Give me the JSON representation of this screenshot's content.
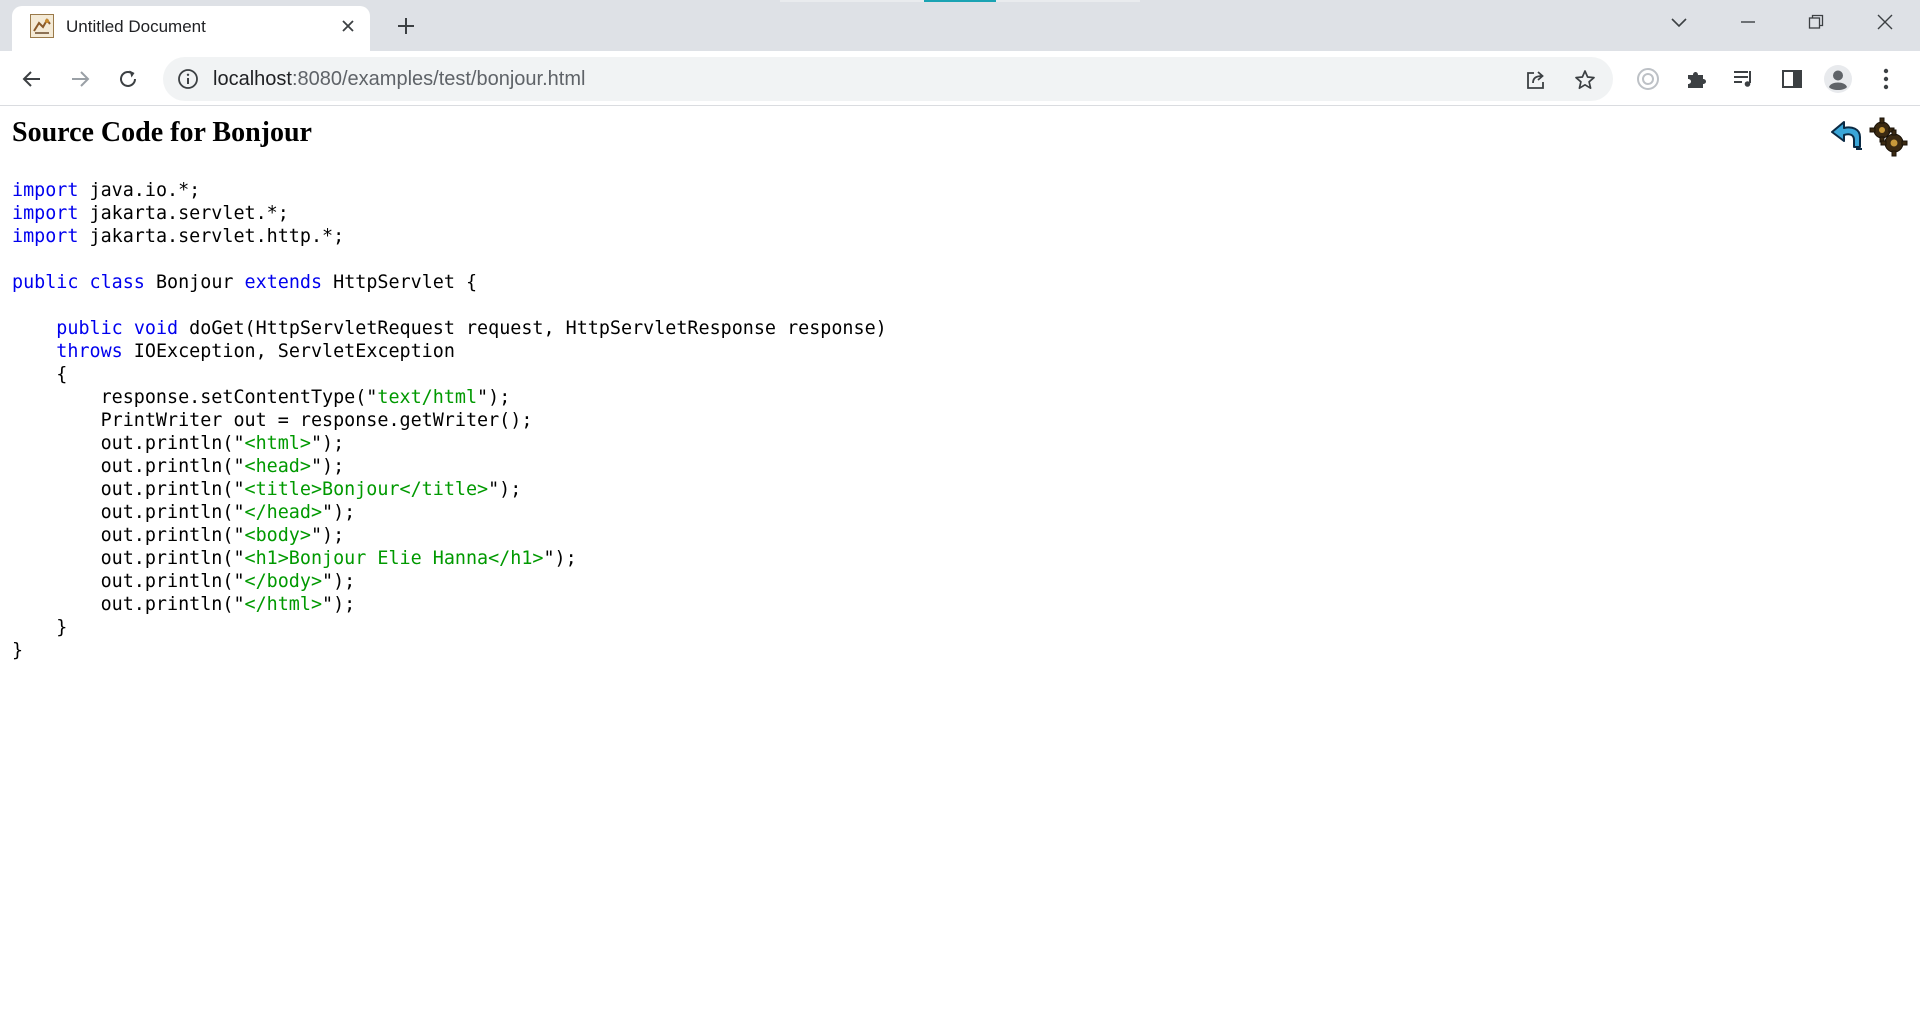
{
  "browser": {
    "tab": {
      "title": "Untitled Document"
    },
    "url": {
      "host": "localhost",
      "path": ":8080/examples/test/bonjour.html"
    }
  },
  "page": {
    "title": "Source Code for Bonjour",
    "code_lines": [
      [
        {
          "t": "import",
          "c": "kw"
        },
        {
          "t": " java.io.*;"
        }
      ],
      [
        {
          "t": "import",
          "c": "kw"
        },
        {
          "t": " jakarta.servlet.*;"
        }
      ],
      [
        {
          "t": "import",
          "c": "kw"
        },
        {
          "t": " jakarta.servlet.http.*;"
        }
      ],
      [],
      [
        {
          "t": "public",
          "c": "kw"
        },
        {
          "t": " "
        },
        {
          "t": "class",
          "c": "kw"
        },
        {
          "t": " Bonjour "
        },
        {
          "t": "extends",
          "c": "kw"
        },
        {
          "t": " HttpServlet {"
        }
      ],
      [],
      [
        {
          "t": "    "
        },
        {
          "t": "public",
          "c": "kw"
        },
        {
          "t": " "
        },
        {
          "t": "void",
          "c": "kw"
        },
        {
          "t": " doGet(HttpServletRequest request, HttpServletResponse response)"
        }
      ],
      [
        {
          "t": "    "
        },
        {
          "t": "throws",
          "c": "kw"
        },
        {
          "t": " IOException, ServletException"
        }
      ],
      [
        {
          "t": "    {"
        }
      ],
      [
        {
          "t": "        response.setContentType(\""
        },
        {
          "t": "text/html",
          "c": "str"
        },
        {
          "t": "\");"
        }
      ],
      [
        {
          "t": "        PrintWriter out = response.getWriter();"
        }
      ],
      [
        {
          "t": "        out.println(\""
        },
        {
          "t": "<html>",
          "c": "str"
        },
        {
          "t": "\");"
        }
      ],
      [
        {
          "t": "        out.println(\""
        },
        {
          "t": "<head>",
          "c": "str"
        },
        {
          "t": "\");"
        }
      ],
      [
        {
          "t": "        out.println(\""
        },
        {
          "t": "<title>Bonjour</title>",
          "c": "str"
        },
        {
          "t": "\");"
        }
      ],
      [
        {
          "t": "        out.println(\""
        },
        {
          "t": "</head>",
          "c": "str"
        },
        {
          "t": "\");"
        }
      ],
      [
        {
          "t": "        out.println(\""
        },
        {
          "t": "<body>",
          "c": "str"
        },
        {
          "t": "\");"
        }
      ],
      [
        {
          "t": "        out.println(\""
        },
        {
          "t": "<h1>Bonjour Elie Hanna</h1>",
          "c": "str"
        },
        {
          "t": "\");"
        }
      ],
      [
        {
          "t": "        out.println(\""
        },
        {
          "t": "</body>",
          "c": "str"
        },
        {
          "t": "\");"
        }
      ],
      [
        {
          "t": "        out.println(\""
        },
        {
          "t": "</html>",
          "c": "str"
        },
        {
          "t": "\");"
        }
      ],
      [
        {
          "t": "    }"
        }
      ],
      [
        {
          "t": "}"
        }
      ]
    ]
  },
  "icons": {
    "tab_favicon": "tomcat-favicon-icon",
    "tab_close": "close-icon",
    "new_tab": "plus-icon",
    "tab_search": "chevron-down-icon",
    "minimize": "minimize-icon",
    "restore": "restore-icon",
    "close_window": "close-window-icon",
    "back": "back-arrow-icon",
    "forward": "forward-arrow-icon",
    "reload": "reload-icon",
    "site_info": "info-icon",
    "share": "share-icon",
    "bookmark": "star-icon",
    "extension_1": "extension-circle-icon",
    "extensions": "puzzle-icon",
    "media": "media-queue-icon",
    "side_panel": "side-panel-icon",
    "profile": "profile-avatar-icon",
    "menu": "kebab-menu-icon",
    "return": "return-arrow-icon",
    "execute": "gears-icon"
  },
  "colors": {
    "tab_strip": "#dee1e6",
    "omnibox": "#f1f3f4",
    "keyword": "#0000ee",
    "string": "#009900",
    "accent": "#1aa3b3"
  }
}
